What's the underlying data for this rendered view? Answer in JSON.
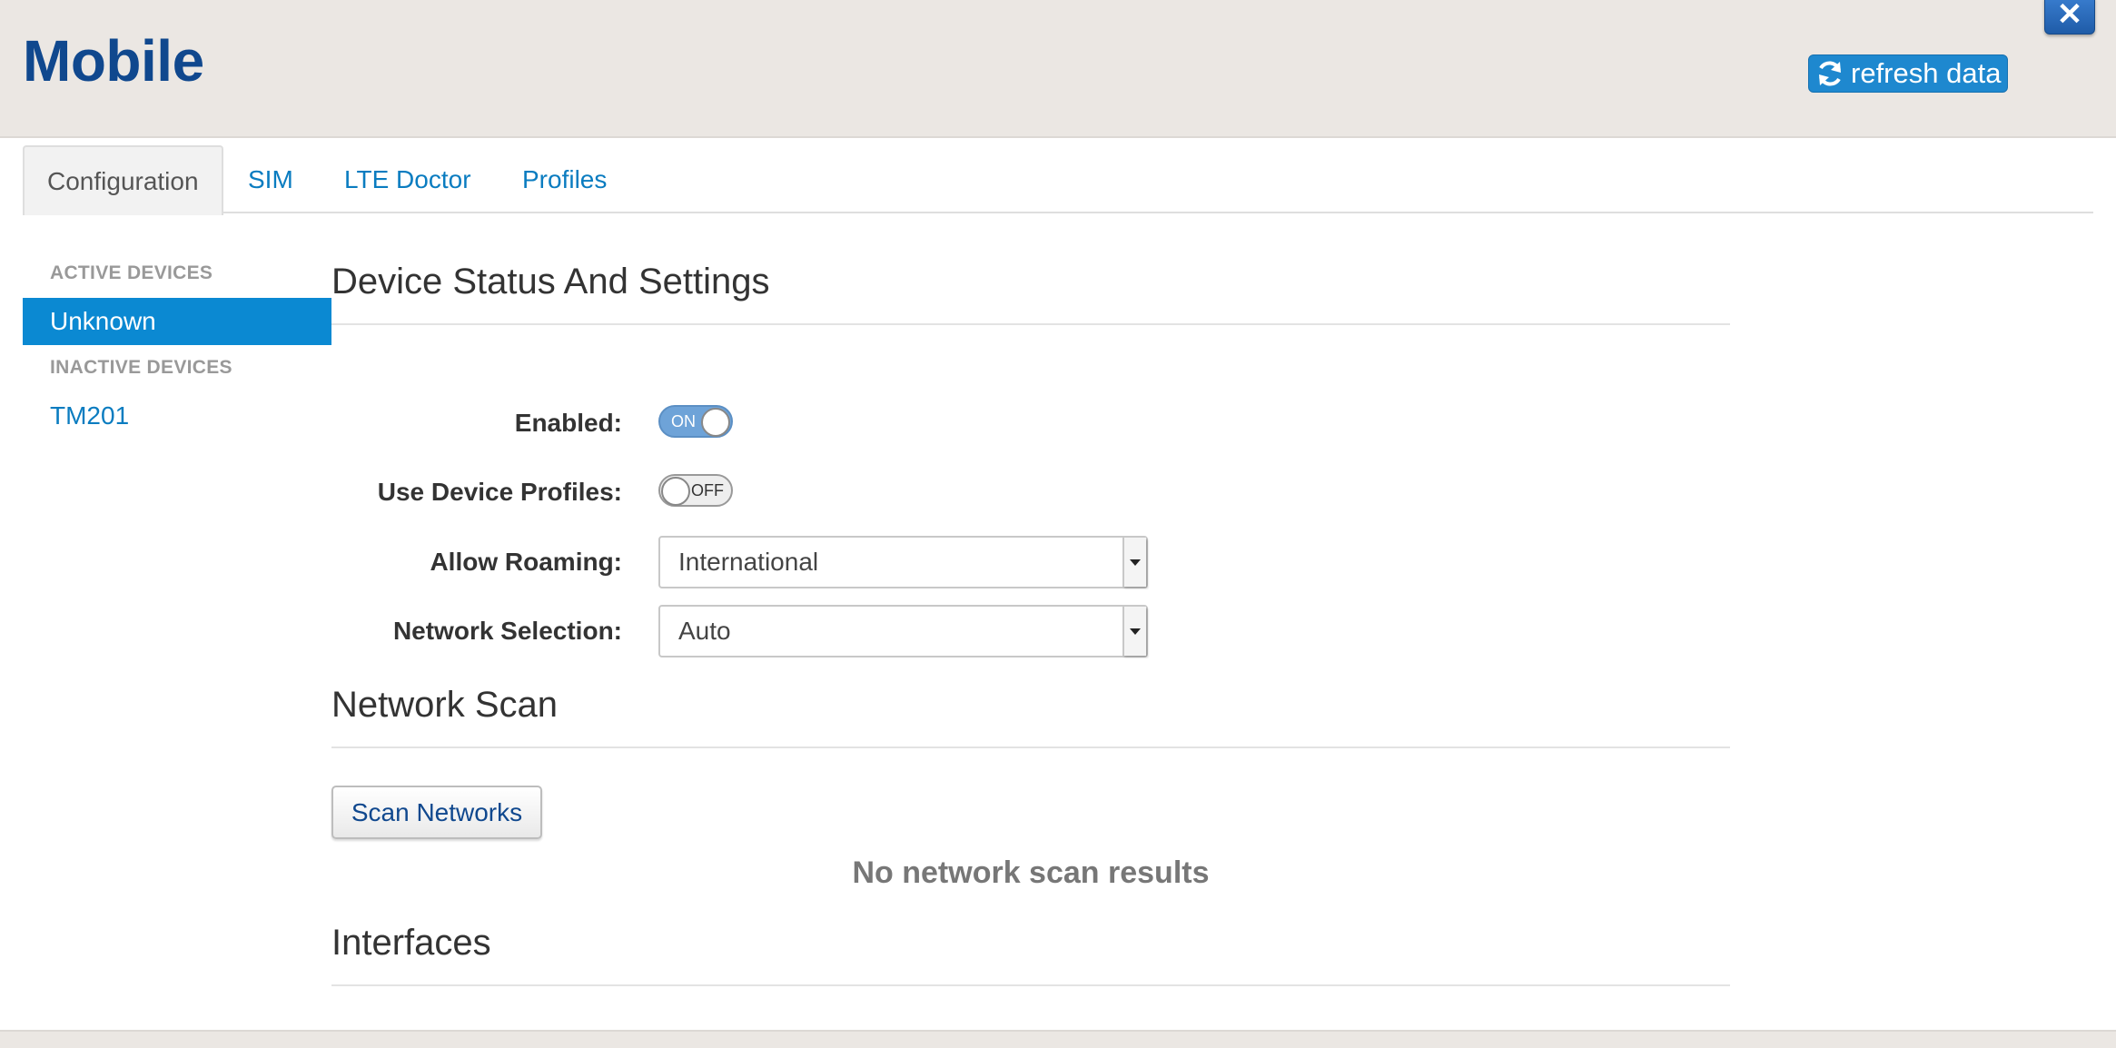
{
  "header": {
    "title": "Mobile",
    "refresh_label": "refresh data",
    "close_glyph": "✕"
  },
  "tabs": [
    {
      "label": "Configuration",
      "active": true
    },
    {
      "label": "SIM"
    },
    {
      "label": "LTE Doctor"
    },
    {
      "label": "Profiles"
    }
  ],
  "sidebar": {
    "active_heading": "ACTIVE DEVICES",
    "active_devices": [
      {
        "label": "Unknown",
        "selected": true
      }
    ],
    "inactive_heading": "INACTIVE DEVICES",
    "inactive_devices": [
      {
        "label": "TM201"
      }
    ]
  },
  "device_settings": {
    "title": "Device Status And Settings",
    "enabled": {
      "label": "Enabled:",
      "state": "ON"
    },
    "use_profiles": {
      "label": "Use Device Profiles:",
      "state": "OFF"
    },
    "allow_roaming": {
      "label": "Allow Roaming:",
      "value": "International"
    },
    "network_selection": {
      "label": "Network Selection:",
      "value": "Auto"
    }
  },
  "network_scan": {
    "title": "Network Scan",
    "button_label": "Scan Networks",
    "empty_text": "No network scan results"
  },
  "interfaces": {
    "title": "Interfaces"
  },
  "colors": {
    "brand": "#10488e",
    "accent": "#0b89d2",
    "header_bg": "#ebe7e3"
  }
}
